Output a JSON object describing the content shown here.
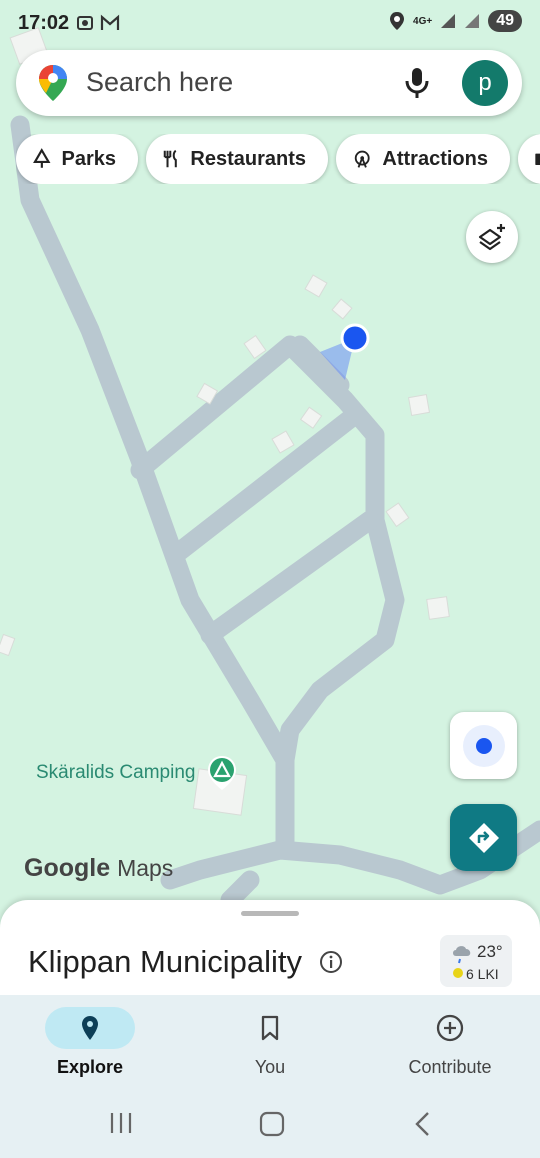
{
  "status_bar": {
    "time": "17:02",
    "network": "4G+",
    "battery": "49"
  },
  "search": {
    "placeholder": "Search here",
    "avatar_letter": "p"
  },
  "chips": [
    {
      "label": "Parks",
      "icon": "tree-icon"
    },
    {
      "label": "Restaurants",
      "icon": "fork-knife-icon"
    },
    {
      "label": "Attractions",
      "icon": "ferris-wheel-icon"
    }
  ],
  "map": {
    "place_label": "Skäralids Camping",
    "logo": {
      "google": "Google",
      "maps": "Maps"
    }
  },
  "sheet": {
    "title": "Klippan Municipality",
    "weather": {
      "temp": "23°",
      "aqi": "6 LKI"
    }
  },
  "nav": {
    "items": [
      {
        "label": "Explore",
        "icon": "pin-icon",
        "active": true
      },
      {
        "label": "You",
        "icon": "bookmark-icon",
        "active": false
      },
      {
        "label": "Contribute",
        "icon": "plus-circle-icon",
        "active": false
      }
    ]
  },
  "colors": {
    "map_bg": "#d4f3e1",
    "road": "#b9c8d0",
    "accent_teal": "#0f7a84",
    "location_blue": "#1a56f0"
  }
}
